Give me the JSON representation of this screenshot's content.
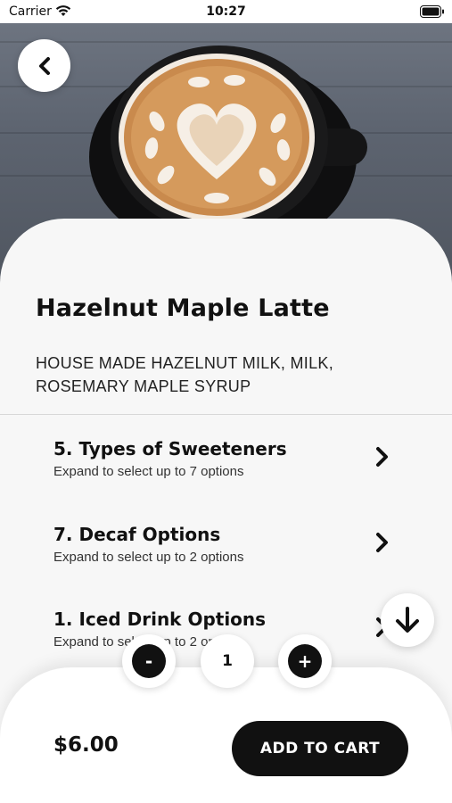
{
  "status_bar": {
    "carrier": "Carrier",
    "time": "10:27"
  },
  "product": {
    "name": "Hazelnut Maple Latte",
    "description": "HOUSE MADE HAZELNUT MILK, MILK, ROSEMARY MAPLE SYRUP"
  },
  "options": [
    {
      "title": "5. Types of Sweeteners",
      "subtitle": "Expand to select up to 7 options"
    },
    {
      "title": "7. Decaf Options",
      "subtitle": "Expand to select up to 2 options"
    },
    {
      "title": "1. Iced Drink Options",
      "subtitle": "Expand to select up to 2 options"
    }
  ],
  "quantity": {
    "minus_label": "-",
    "value": "1",
    "plus_label": "+"
  },
  "cart": {
    "price": "$6.00",
    "add_label": "ADD TO CART"
  },
  "icons": {
    "back": "chevron-left-icon",
    "option_chevron": "chevron-right-icon",
    "scroll": "arrow-down-icon"
  },
  "colors": {
    "accent": "#111111",
    "background": "#f7f7f7",
    "surface": "#ffffff"
  }
}
